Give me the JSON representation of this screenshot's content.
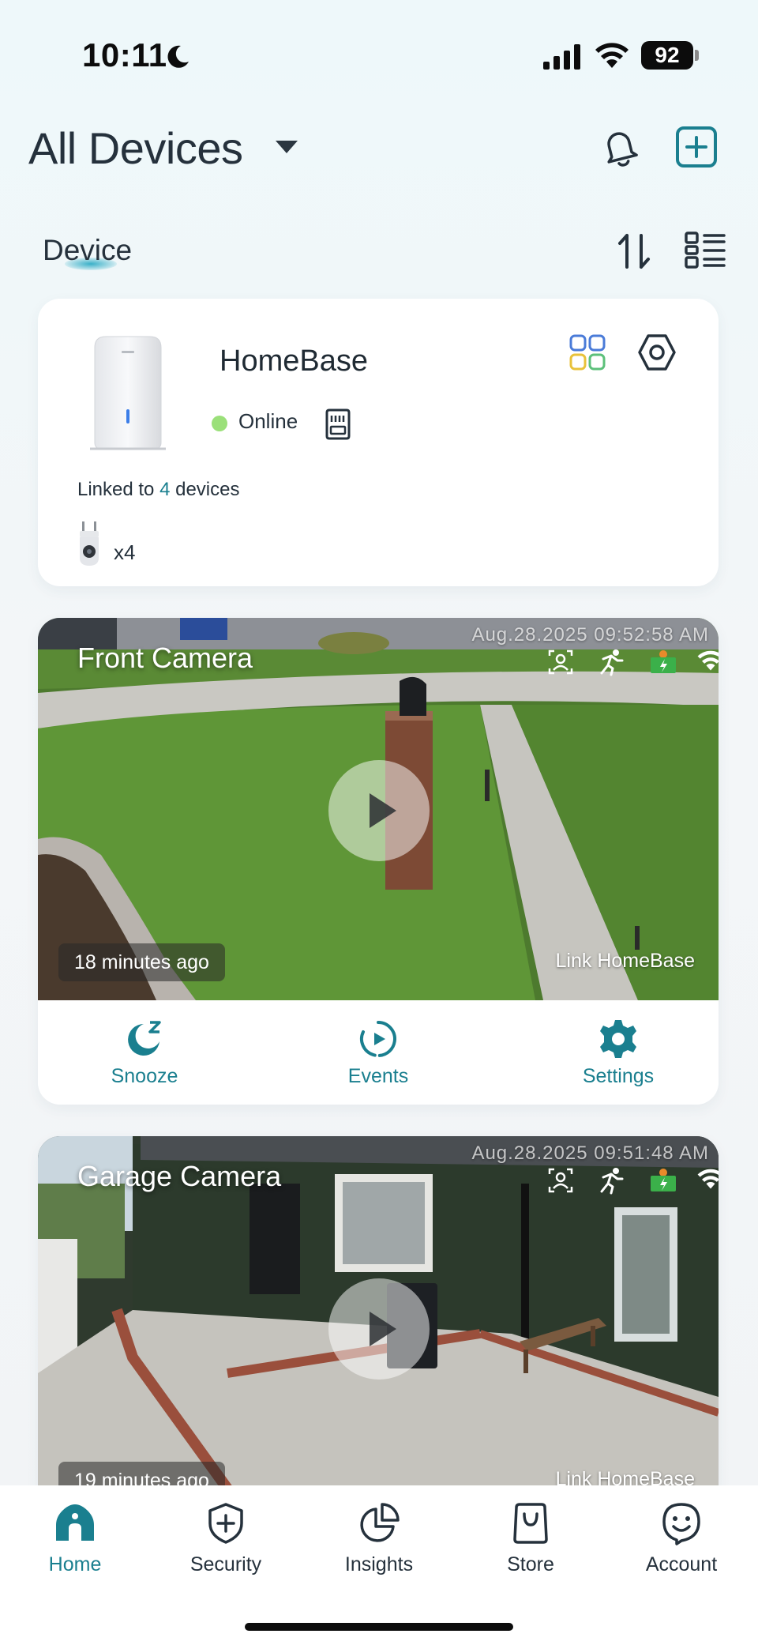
{
  "status_bar": {
    "time": "10:11",
    "battery": "92"
  },
  "header": {
    "title": "All Devices"
  },
  "section": {
    "label": "Device"
  },
  "homebase": {
    "name": "HomeBase",
    "status": "Online",
    "linked_prefix": "Linked to ",
    "linked_count": "4",
    "linked_suffix": " devices",
    "camera_count": "x4"
  },
  "cameras": [
    {
      "name": "Front Camera",
      "timestamp": "Aug.28.2025 09:52:58 AM",
      "last_seen": "18 minutes ago",
      "link_label": "Link HomeBase",
      "actions": [
        "Snooze",
        "Events",
        "Settings"
      ]
    },
    {
      "name": "Garage Camera",
      "timestamp": "Aug.28.2025 09:51:48 AM",
      "last_seen": "19 minutes ago",
      "link_label": "Link HomeBase"
    }
  ],
  "nav": {
    "items": [
      {
        "label": "Home",
        "icon": "home-icon",
        "active": true
      },
      {
        "label": "Security",
        "icon": "shield-plus-icon",
        "active": false
      },
      {
        "label": "Insights",
        "icon": "pie-chart-icon",
        "active": false
      },
      {
        "label": "Store",
        "icon": "shopping-bag-icon",
        "active": false
      },
      {
        "label": "Account",
        "icon": "smiley-icon",
        "active": false
      }
    ]
  },
  "colors": {
    "accent": "#1a7f8f",
    "online": "#9be07a"
  }
}
